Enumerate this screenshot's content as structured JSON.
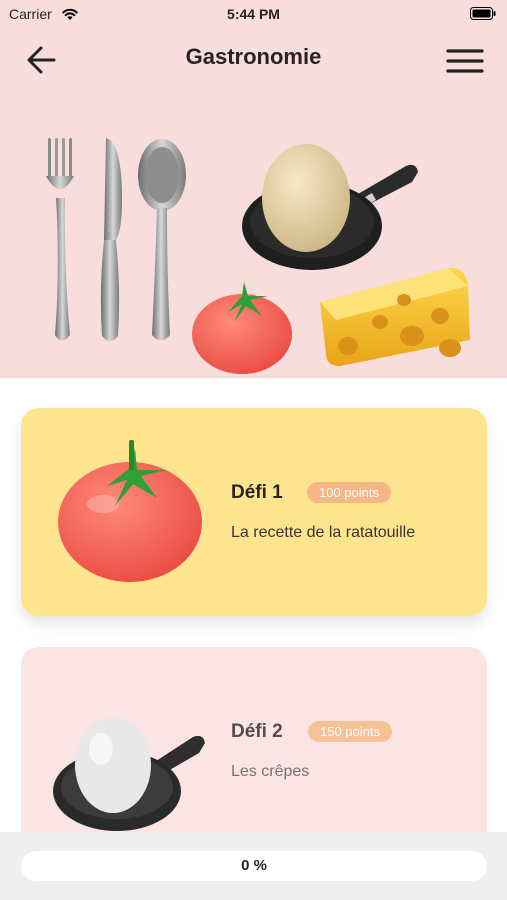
{
  "status_bar": {
    "carrier": "Carrier",
    "time": "5:44 PM"
  },
  "header": {
    "title": "Gastronomie",
    "back_icon": "arrow-left-icon",
    "menu_icon": "hamburger-menu-icon"
  },
  "hero": {
    "illustrations": [
      "fork",
      "knife",
      "spoon",
      "egg-in-pan",
      "tomato",
      "cheese"
    ]
  },
  "challenges": [
    {
      "title": "Défi 1",
      "points": "100 points",
      "description": "La recette de la ratatouille",
      "illustration": "tomato",
      "status": "active"
    },
    {
      "title": "Défi 2",
      "points": "150 points",
      "description": "Les crêpes",
      "illustration": "egg-in-pan",
      "status": "locked"
    }
  ],
  "progress": {
    "label": "0 %",
    "value": 0
  },
  "colors": {
    "hero_bg": "#f8dddd",
    "active_card": "#fde48e",
    "locked_card": "#fbe4e4",
    "badge": "#f5b786"
  }
}
